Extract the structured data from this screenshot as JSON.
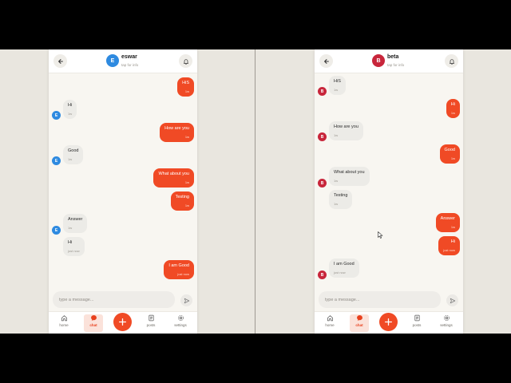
{
  "colors": {
    "accent": "#f04a25",
    "incoming_bubble": "#ecebe7",
    "avatar_eswar": "#2e8ae0",
    "avatar_beta": "#c8263b"
  },
  "left_phone": {
    "header": {
      "name": "eswar",
      "sub": "tap for info",
      "avatar_letter": "E"
    },
    "messages": [
      {
        "text": "HiS",
        "time": "1w"
      },
      {
        "text": "Hi",
        "time": "1w"
      },
      {
        "text": "How are you",
        "time": "1w"
      },
      {
        "text": "Good",
        "time": "1w"
      },
      {
        "text": "What about you",
        "time": "1w"
      },
      {
        "text": "Testing",
        "time": "1w"
      },
      {
        "text": "Answer",
        "time": "1w"
      },
      {
        "text": "Hi",
        "time": "just now"
      },
      {
        "text": "I am Good",
        "time": "just now"
      }
    ],
    "input_placeholder": "type a message...",
    "nav": {
      "home": "home",
      "chat": "chat",
      "posts": "posts",
      "settings": "settings"
    }
  },
  "right_phone": {
    "header": {
      "name": "beta",
      "sub": "tap for info",
      "avatar_letter": "B"
    },
    "messages": [
      {
        "text": "HiS",
        "time": "1w"
      },
      {
        "text": "Hi",
        "time": "1w"
      },
      {
        "text": "How are you",
        "time": "1w"
      },
      {
        "text": "Good",
        "time": "1w"
      },
      {
        "text": "What about you",
        "time": "1w"
      },
      {
        "text": "Testing",
        "time": "1w"
      },
      {
        "text": "Answer",
        "time": "1w"
      },
      {
        "text": "Hi",
        "time": "just now"
      },
      {
        "text": "I am Good",
        "time": "just now"
      }
    ],
    "input_placeholder": "type a message...",
    "nav": {
      "home": "home",
      "chat": "chat",
      "posts": "posts",
      "settings": "settings"
    }
  },
  "icons": {
    "back": "arrow-left-icon",
    "bell": "bell-icon",
    "send": "send-icon",
    "home": "home-icon",
    "chat": "chat-bubble-icon",
    "add": "plus-icon",
    "posts": "document-icon",
    "settings": "gear-icon",
    "cursor": "mouse-pointer-icon"
  }
}
